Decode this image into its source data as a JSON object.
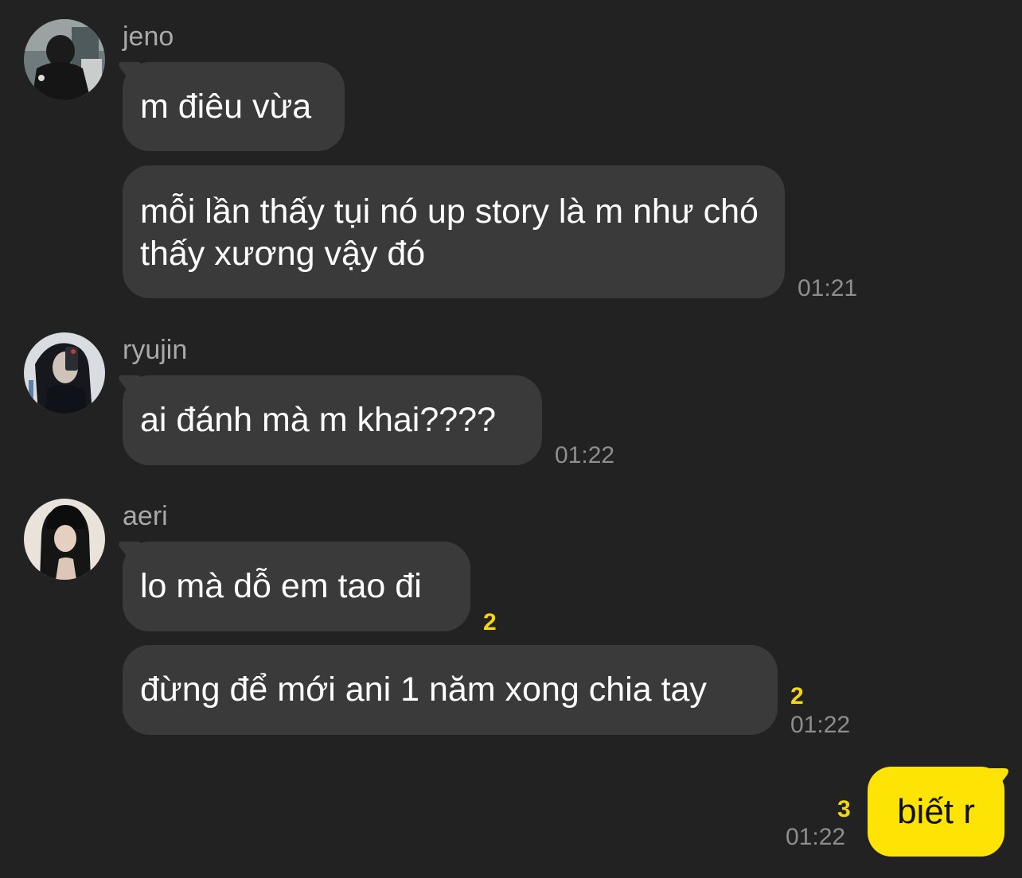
{
  "chat": {
    "groups": [
      {
        "sender": "jeno",
        "avatar_icon": "profile-photo-icon",
        "messages": [
          "m điêu vừa",
          "mỗi lần thấy tụi nó up story là m như chó thấy xương vậy đó"
        ],
        "time": "01:21"
      },
      {
        "sender": "ryujin",
        "avatar_icon": "profile-photo-icon",
        "messages": [
          "ai đánh mà m khai????"
        ],
        "time": "01:22"
      },
      {
        "sender": "aeri",
        "avatar_icon": "profile-photo-icon",
        "messages": [
          "lo mà dỗ em tao đi",
          "đừng để mới ani 1 năm xong chia tay"
        ],
        "unread": [
          "2",
          "2"
        ],
        "time": "01:22"
      }
    ],
    "mine": {
      "text": "biết r",
      "unread": "3",
      "time": "01:22"
    }
  },
  "colors": {
    "background": "#222222",
    "bubble_other": "#3a3a3a",
    "bubble_mine": "#fde404",
    "unread_count": "#f5d70f",
    "timestamp": "#8e8e8e",
    "sender_name": "#a9a9a9"
  }
}
